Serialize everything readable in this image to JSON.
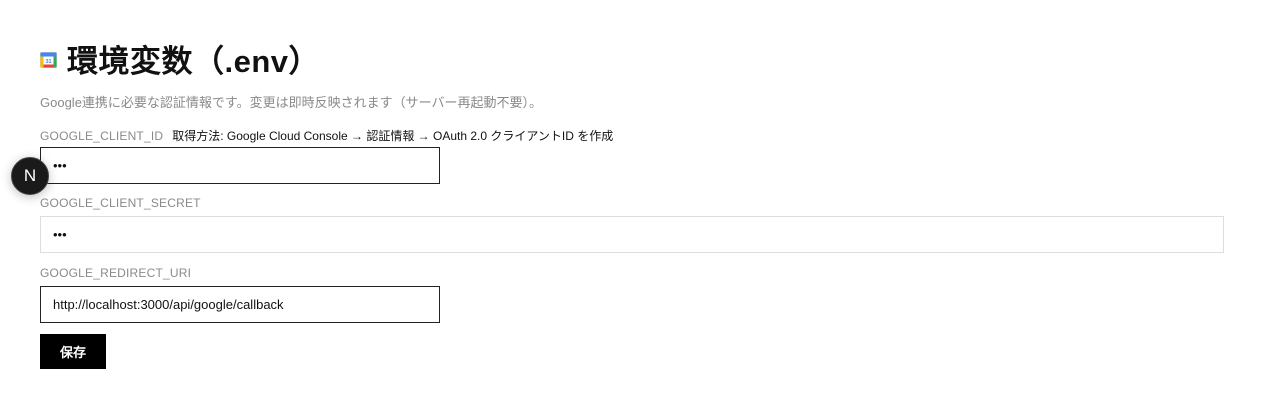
{
  "header": {
    "icon": "calendar-icon",
    "title": "環境変数（.env）"
  },
  "description": "Google連携に必要な認証情報です。変更は即時反映されます（サーバー再起動不要）。",
  "fields": {
    "client_id": {
      "label": "GOOGLE_CLIENT_ID",
      "hint": "取得方法: Google Cloud Console → 認証情報 → OAuth 2.0 クライアントID を作成",
      "value": "•••"
    },
    "client_secret": {
      "label": "GOOGLE_CLIENT_SECRET",
      "value": "•••"
    },
    "redirect_uri": {
      "label": "GOOGLE_REDIRECT_URI",
      "value": "http://localhost:3000/api/google/callback"
    }
  },
  "save_label": "保存",
  "next_badge": {
    "icon": "nextjs-icon",
    "label": "N"
  }
}
